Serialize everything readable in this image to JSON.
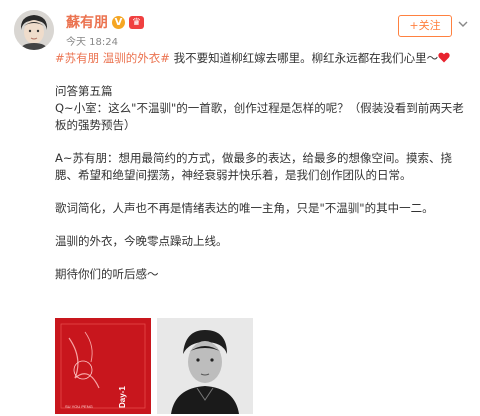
{
  "post": {
    "username": "蘇有朋",
    "vip_badge": "♛",
    "verified_badge": "V",
    "time": "今天 18:24",
    "follow_label": "+关注",
    "tags": "#苏有朋 温驯的外衣#",
    "intro": " 我不要知道柳红嫁去哪里。柳红永远都在我们心里～",
    "heading": "问答第五篇",
    "question": "Q~小室：这么\"不温驯\"的一首歌，创作过程是怎样的呢？（假装没看到前两天老板的强势预告）",
    "answer": "A~苏有朋：想用最简约的方式，做最多的表达，给最多的想像空间。摸索、挠腮、希望和绝望间摆荡，神经衰弱并快乐着，是我们创作团队的日常。",
    "line3": "歌词简化，人声也不再是情绪表达的唯一主角，只是\"不温驯\"的其中一二。",
    "line4": "温驯的外衣，今晚零点躁动上线。",
    "line5": "期待你们的听后感～",
    "image1_text": "Day-1",
    "accent": "#eb7350",
    "follow_color": "#ff8140"
  },
  "icons": [
    "avatar",
    "verified-icon",
    "vip-icon",
    "chevron-down-icon",
    "heart-icon"
  ]
}
